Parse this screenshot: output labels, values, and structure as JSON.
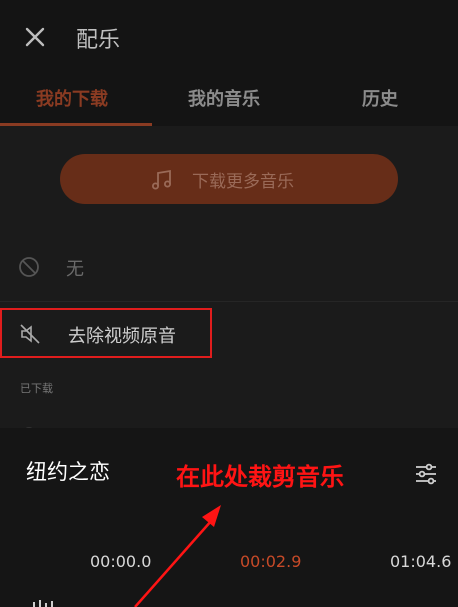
{
  "header": {
    "title": "配乐",
    "close_icon": "close-icon"
  },
  "tabs": [
    {
      "label": "我的下载",
      "active": true
    },
    {
      "label": "我的音乐",
      "active": false
    },
    {
      "label": "历史",
      "active": false
    }
  ],
  "download_more": {
    "label": "下载更多音乐",
    "icon": "music-note-icon"
  },
  "list": {
    "none_label": "无",
    "remove_original_label": "去除视频原音",
    "downloaded_section": "已下载"
  },
  "player": {
    "song_title": "纽约之恋",
    "start_time": "00:00.0",
    "current_time": "00:02.9",
    "end_time": "01:04.6",
    "settings_icon": "sliders-icon"
  },
  "annotation": {
    "text": "在此处裁剪音乐"
  },
  "colors": {
    "accent": "#8a3b22",
    "button_bg": "#672d18",
    "highlight_red": "#e01d1d",
    "current_time": "#c74a28"
  }
}
